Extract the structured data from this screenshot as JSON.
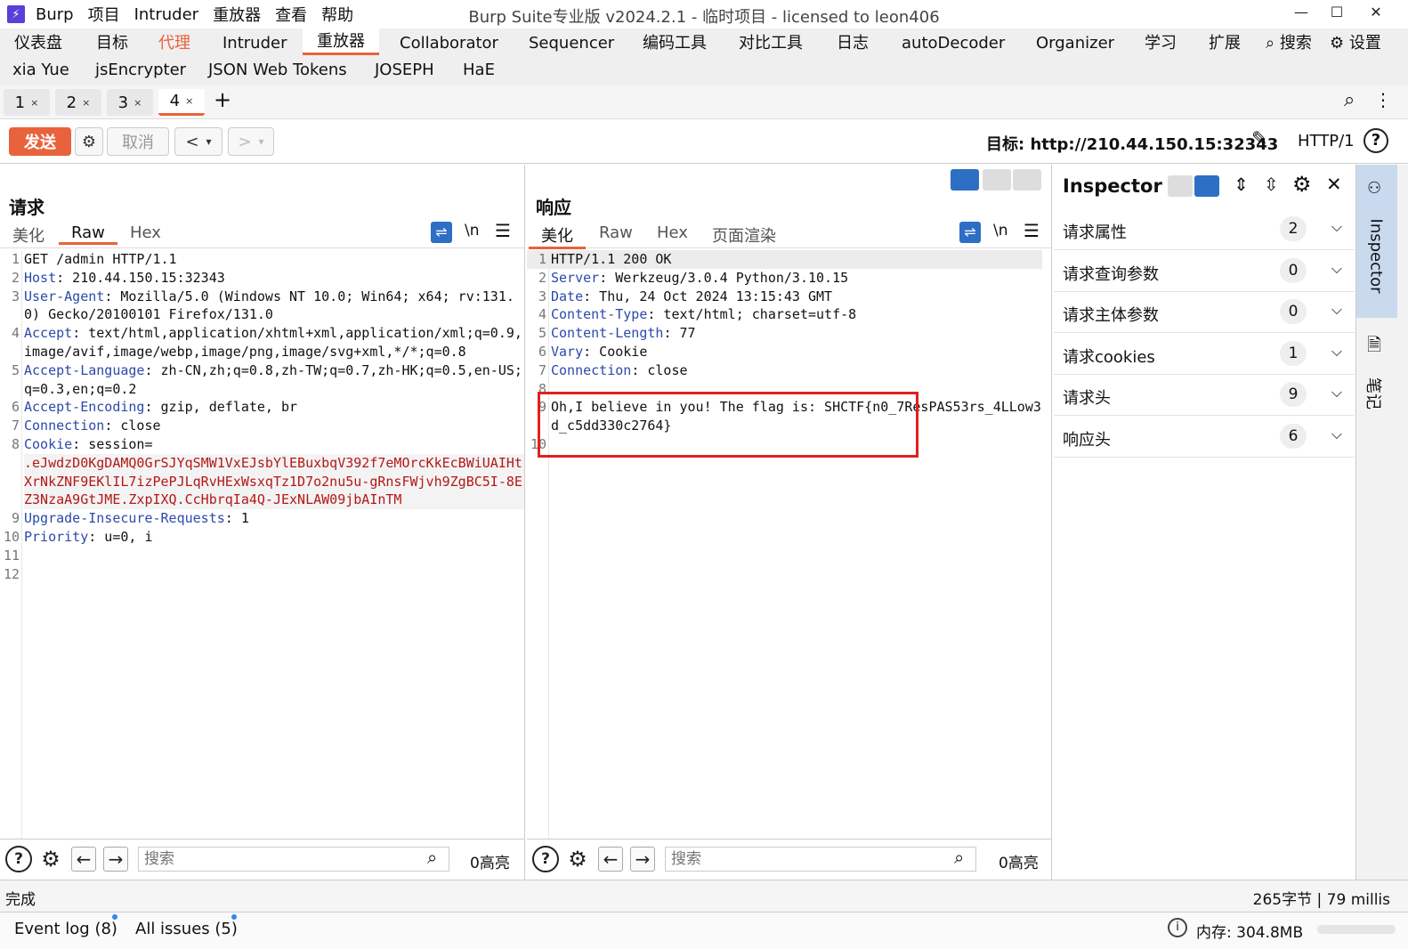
{
  "titlebar": {
    "logo": "⚡",
    "menus": [
      "Burp",
      "项目",
      "Intruder",
      "重放器",
      "查看",
      "帮助"
    ],
    "title": "Burp Suite专业版  v2024.2.1 - 临时项目 - licensed to leon406",
    "min": "—",
    "max": "☐",
    "close": "✕"
  },
  "maintabs": {
    "row1": [
      "仪表盘",
      "目标",
      "代理",
      "Intruder",
      "重放器",
      "Collaborator",
      "Sequencer",
      "编码工具",
      "对比工具",
      "日志",
      "autoDecoder",
      "Organizer",
      "学习",
      "扩展"
    ],
    "search": "搜索",
    "settings": "设置",
    "row2": [
      "xia Yue",
      "jsEncrypter",
      "JSON Web Tokens",
      "JOSEPH",
      "HaE"
    ]
  },
  "reptabs": [
    "1",
    "2",
    "3",
    "4"
  ],
  "reptab_close": "×",
  "reptab_add": "+",
  "actionbar": {
    "send": "发送",
    "cancel": "取消",
    "back": "<",
    "forward": ">",
    "dropdown": "▾",
    "target_label": "目标: http://210.44.150.15:32343",
    "http_version": "HTTP/1",
    "help": "?"
  },
  "request": {
    "title": "请求",
    "tabs": [
      "美化",
      "Raw",
      "Hex"
    ],
    "newline_toggle": "\\n",
    "menu": "☰",
    "lines": [
      {
        "n": "1",
        "k": "",
        "v": "GET /admin HTTP/1.1"
      },
      {
        "n": "2",
        "k": "Host",
        "v": ": 210.44.150.15:32343"
      },
      {
        "n": "3",
        "k": "User-Agent",
        "v": ": Mozilla/5.0 (Windows NT 10.0; Win64; x64; rv:131.0) Gecko/20100101 Firefox/131.0"
      },
      {
        "n": "4",
        "k": "Accept",
        "v": ": text/html,application/xhtml+xml,application/xml;q=0.9,image/avif,image/webp,image/png,image/svg+xml,*/*;q=0.8"
      },
      {
        "n": "5",
        "k": "Accept-Language",
        "v": ": zh-CN,zh;q=0.8,zh-TW;q=0.7,zh-HK;q=0.5,en-US;q=0.3,en;q=0.2"
      },
      {
        "n": "6",
        "k": "Accept-Encoding",
        "v": ": gzip, deflate, br"
      },
      {
        "n": "7",
        "k": "Connection",
        "v": ": close"
      },
      {
        "n": "8",
        "k": "Cookie",
        "v": ": session=",
        "cookie": ".eJwdzD0KgDAMQ0GrSJYqSMW1VxEJsbYlEBuxbqV392f7eMOrcKkEcBWiUAIHtXrNkZNF9EKlIL7izPePJLqRvHExWsxqTz1D7o2nu5u-gRnsFWjvh9ZgBC5I-8EZ3NzaA9GtJME.ZxpIXQ.CcHbrqIa4Q-JExNLAW09jbAInTM"
      },
      {
        "n": "9",
        "k": "Upgrade-Insecure-Requests",
        "v": ": 1"
      },
      {
        "n": "10",
        "k": "Priority",
        "v": ": u=0, i"
      },
      {
        "n": "11",
        "k": "",
        "v": ""
      },
      {
        "n": "12",
        "k": "",
        "v": ""
      }
    ],
    "search_placeholder": "搜索",
    "highlights": "0高亮"
  },
  "response": {
    "title": "响应",
    "tabs": [
      "美化",
      "Raw",
      "Hex",
      "页面渲染"
    ],
    "newline_toggle": "\\n",
    "menu": "☰",
    "lines": [
      {
        "n": "1",
        "k": "",
        "v": "HTTP/1.1 200 OK"
      },
      {
        "n": "2",
        "k": "Server",
        "v": ": Werkzeug/3.0.4 Python/3.10.15"
      },
      {
        "n": "3",
        "k": "Date",
        "v": ": Thu, 24 Oct 2024 13:15:43 GMT"
      },
      {
        "n": "4",
        "k": "Content-Type",
        "v": ": text/html; charset=utf-8"
      },
      {
        "n": "5",
        "k": "Content-Length",
        "v": ": 77"
      },
      {
        "n": "6",
        "k": "Vary",
        "v": ": Cookie"
      },
      {
        "n": "7",
        "k": "Connection",
        "v": ": close"
      },
      {
        "n": "8",
        "k": "",
        "v": ""
      },
      {
        "n": "9",
        "k": "",
        "v": "Oh,I believe in you! The flag is: SHCTF{n0_7ResPAS53rs_4LLow3d_c5dd330c2764}"
      },
      {
        "n": "10",
        "k": "",
        "v": ""
      }
    ],
    "search_placeholder": "搜索",
    "highlights": "0高亮"
  },
  "inspector": {
    "title": "Inspector",
    "rows": [
      {
        "label": "请求属性",
        "count": "2"
      },
      {
        "label": "请求查询参数",
        "count": "0"
      },
      {
        "label": "请求主体参数",
        "count": "0"
      },
      {
        "label": "请求cookies",
        "count": "1"
      },
      {
        "label": "请求头",
        "count": "9"
      },
      {
        "label": "响应头",
        "count": "6"
      }
    ],
    "close": "✕"
  },
  "side_rail": {
    "inspector": "Inspector",
    "notes": "笔记"
  },
  "status": {
    "left": "完成",
    "right": "265字节 | 79 millis"
  },
  "bottombar": {
    "event_log": "Event log (8)",
    "all_issues": "All issues (5)",
    "memory": "内存: 304.8MB"
  },
  "colors": {
    "accent": "#e8633b",
    "highlight_box": "#e02020",
    "header_key": "#2b4aa8",
    "cookie": "#b41818"
  }
}
